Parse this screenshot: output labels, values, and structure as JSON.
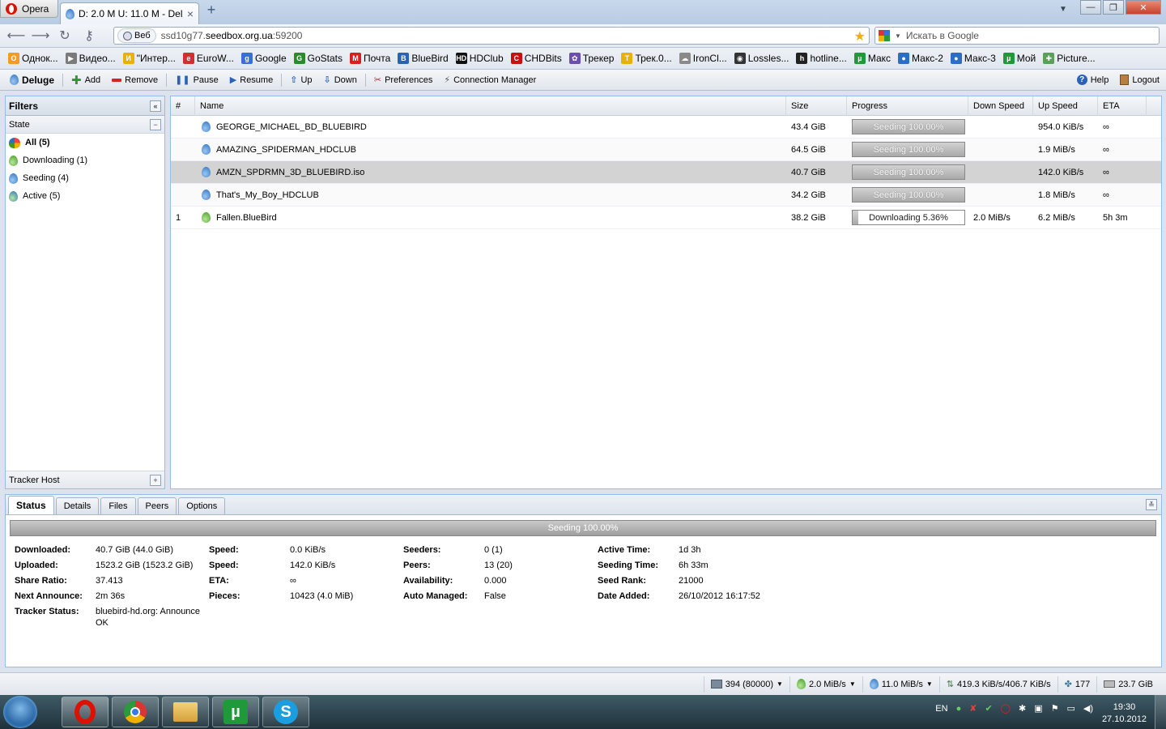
{
  "browser": {
    "menu_label": "Opera",
    "tab_title": "D: 2.0 M U: 11.0 M - Del...",
    "tab_close": "×",
    "new_tab": "+",
    "address_badge": "Веб",
    "url_prefix": "ssd10g77.",
    "url_host": "seedbox.org.ua",
    "url_suffix": ":59200",
    "search_placeholder": "Искать в Google"
  },
  "bookmarks": [
    {
      "label": "Однок...",
      "color": "#f59a23",
      "glyph": "O"
    },
    {
      "label": "Видео...",
      "color": "#7a7a7a",
      "glyph": "▶"
    },
    {
      "label": "\"Интер...",
      "color": "#e8b200",
      "glyph": "И"
    },
    {
      "label": "EuroW...",
      "color": "#d03030",
      "glyph": "e"
    },
    {
      "label": "Google",
      "color": "#3a6fd8",
      "glyph": "g"
    },
    {
      "label": "GoStats",
      "color": "#2b8a2b",
      "glyph": "G"
    },
    {
      "label": "Почта",
      "color": "#d42020",
      "glyph": "M"
    },
    {
      "label": "BlueBird",
      "color": "#2a62b5",
      "glyph": "B"
    },
    {
      "label": "HDClub",
      "color": "#111111",
      "glyph": "HD"
    },
    {
      "label": "CHDBits",
      "color": "#c81010",
      "glyph": "C"
    },
    {
      "label": "Трекер",
      "color": "#6a4fb0",
      "glyph": "✿"
    },
    {
      "label": "Трек.0...",
      "color": "#e8b200",
      "glyph": "T"
    },
    {
      "label": "IronCl...",
      "color": "#8a8a8a",
      "glyph": "☁"
    },
    {
      "label": "Lossles...",
      "color": "#333333",
      "glyph": "◉"
    },
    {
      "label": "hotline...",
      "color": "#222222",
      "glyph": "h"
    },
    {
      "label": "Макс",
      "color": "#1f9a3a",
      "glyph": "µ"
    },
    {
      "label": "Макс-2",
      "color": "#2a6fc4",
      "glyph": "●"
    },
    {
      "label": "Макс-3",
      "color": "#2a6fc4",
      "glyph": "●"
    },
    {
      "label": "Мой",
      "color": "#1f9a3a",
      "glyph": "µ"
    },
    {
      "label": "Picture...",
      "color": "#5aa05a",
      "glyph": "✚"
    }
  ],
  "toolbar": {
    "app": "Deluge",
    "add": "Add",
    "remove": "Remove",
    "pause": "Pause",
    "resume": "Resume",
    "up": "Up",
    "down": "Down",
    "preferences": "Preferences",
    "connection_manager": "Connection Manager",
    "help": "Help",
    "logout": "Logout"
  },
  "filters": {
    "title": "Filters",
    "state_header": "State",
    "items": [
      {
        "label": "All (5)",
        "icon": "all"
      },
      {
        "label": "Downloading (1)",
        "icon": "green"
      },
      {
        "label": "Seeding (4)",
        "icon": "blue"
      },
      {
        "label": "Active (5)",
        "icon": "mixed"
      }
    ],
    "tracker_host": "Tracker Host"
  },
  "torrents": {
    "columns": [
      "#",
      "Name",
      "Size",
      "Progress",
      "Down Speed",
      "Up Speed",
      "ETA"
    ],
    "rows": [
      {
        "num": "",
        "name": "GEORGE_MICHAEL_BD_BLUEBIRD",
        "size": "43.4 GiB",
        "progress_text": "Seeding 100.00%",
        "progress": 100,
        "down": "",
        "up": "954.0 KiB/s",
        "eta": "∞",
        "icon": "blue"
      },
      {
        "num": "",
        "name": "AMAZING_SPIDERMAN_HDCLUB",
        "size": "64.5 GiB",
        "progress_text": "Seeding 100.00%",
        "progress": 100,
        "down": "",
        "up": "1.9 MiB/s",
        "eta": "∞",
        "icon": "blue"
      },
      {
        "num": "",
        "name": "AMZN_SPDRMN_3D_BLUEBIRD.iso",
        "size": "40.7 GiB",
        "progress_text": "Seeding 100.00%",
        "progress": 100,
        "down": "",
        "up": "142.0 KiB/s",
        "eta": "∞",
        "icon": "blue"
      },
      {
        "num": "",
        "name": "That's_My_Boy_HDCLUB",
        "size": "34.2 GiB",
        "progress_text": "Seeding 100.00%",
        "progress": 100,
        "down": "",
        "up": "1.8 MiB/s",
        "eta": "∞",
        "icon": "blue"
      },
      {
        "num": "1",
        "name": "Fallen.BlueBird",
        "size": "38.2 GiB",
        "progress_text": "Downloading 5.36%",
        "progress": 5.36,
        "down": "2.0 MiB/s",
        "up": "6.2 MiB/s",
        "eta": "5h 3m",
        "icon": "green"
      }
    ]
  },
  "details": {
    "tabs": [
      "Status",
      "Details",
      "Files",
      "Peers",
      "Options"
    ],
    "progress_text": "Seeding 100.00%",
    "col1": [
      {
        "label": "Downloaded:",
        "value": "40.7 GiB (44.0 GiB)"
      },
      {
        "label": "Uploaded:",
        "value": "1523.2 GiB (1523.2 GiB)"
      },
      {
        "label": "Share Ratio:",
        "value": "37.413"
      },
      {
        "label": "Next Announce:",
        "value": "2m 36s"
      },
      {
        "label": "Tracker Status:",
        "value": "bluebird-hd.org: Announce"
      }
    ],
    "tracker_status_line2": "OK",
    "col2": [
      {
        "label": "Speed:",
        "value": "0.0 KiB/s"
      },
      {
        "label": "Speed:",
        "value": "142.0 KiB/s"
      },
      {
        "label": "ETA:",
        "value": "∞"
      },
      {
        "label": "Pieces:",
        "value": "10423 (4.0 MiB)"
      }
    ],
    "col3": [
      {
        "label": "Seeders:",
        "value": "0 (1)"
      },
      {
        "label": "Peers:",
        "value": "13 (20)"
      },
      {
        "label": "Availability:",
        "value": "0.000"
      },
      {
        "label": "Auto Managed:",
        "value": "False"
      }
    ],
    "col4": [
      {
        "label": "Active Time:",
        "value": "1d 3h"
      },
      {
        "label": "Seeding Time:",
        "value": "6h 33m"
      },
      {
        "label": "Seed Rank:",
        "value": "21000"
      },
      {
        "label": "Date Added:",
        "value": "26/10/2012 16:17:52"
      }
    ]
  },
  "statusbar": {
    "connections": "394 (80000)",
    "down_speed": "2.0 MiB/s",
    "up_speed": "11.0 MiB/s",
    "protocol": "419.3 KiB/s/406.7 KiB/s",
    "dht": "177",
    "free_space": "23.7 GiB"
  },
  "taskbar": {
    "lang": "EN",
    "time": "19:30",
    "date": "27.10.2012"
  }
}
